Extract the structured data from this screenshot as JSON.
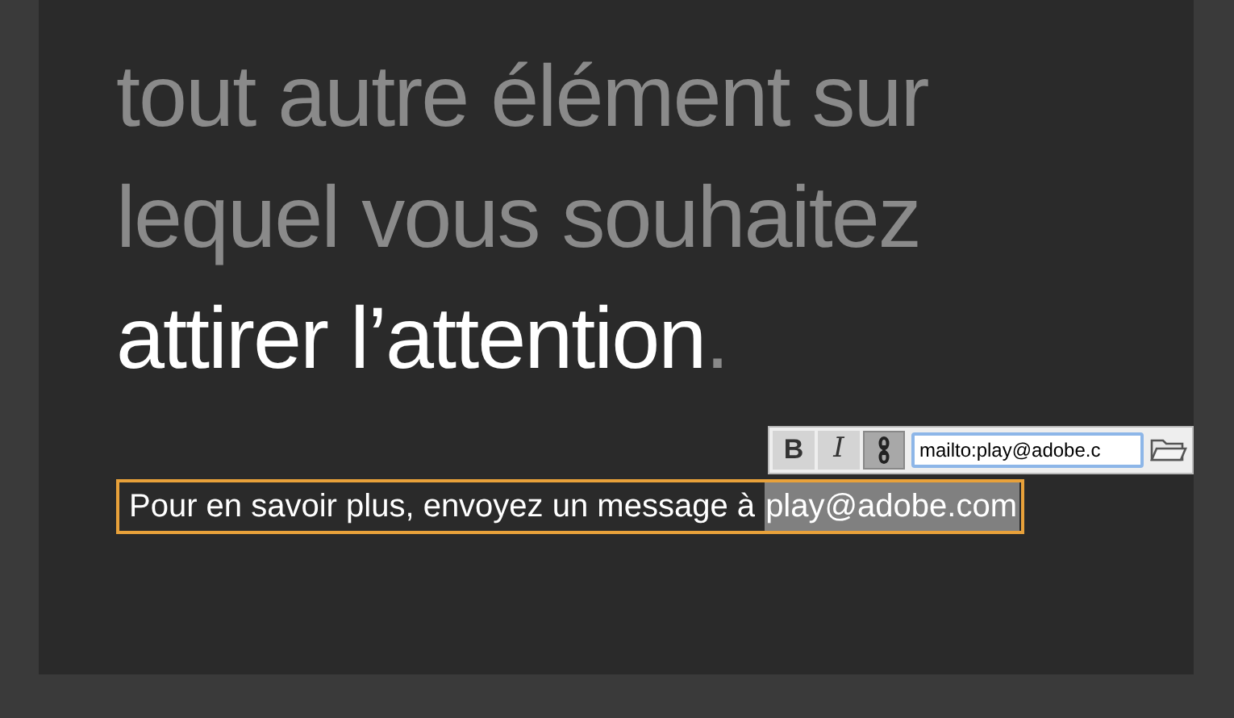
{
  "heading": {
    "lines": [
      [
        {
          "text": "tout autre élément sur",
          "highlighted": false
        }
      ],
      [
        {
          "text": "lequel vous souhaitez",
          "highlighted": false
        }
      ],
      [
        {
          "text": "attirer l’attention",
          "highlighted": true
        },
        {
          "text": ".",
          "highlighted": false
        }
      ]
    ]
  },
  "toolbar": {
    "buttons": [
      {
        "kind": "bold",
        "label": "B",
        "selected": false
      },
      {
        "kind": "italic",
        "label": "I",
        "selected": false
      },
      {
        "kind": "link",
        "selected": true
      }
    ],
    "link_field": {
      "value": "mailto:play@adobe.c"
    }
  },
  "text_box": {
    "text": "Pour en savoir plus, envoyez un message à ",
    "selection": "play@adobe.com"
  }
}
